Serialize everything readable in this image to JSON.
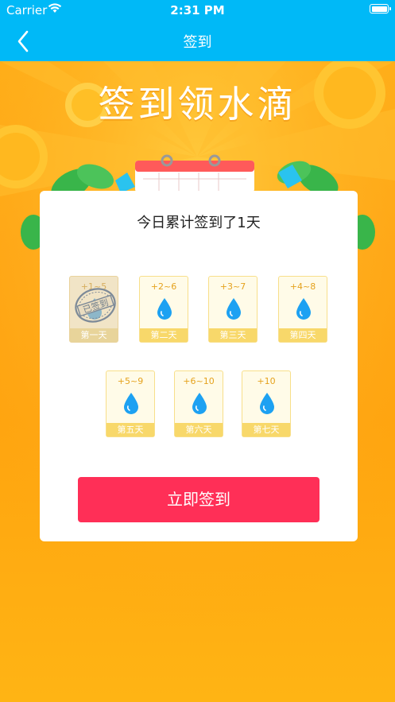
{
  "status_bar": {
    "carrier": "Carrier",
    "time": "2:31 PM"
  },
  "nav": {
    "title": "签到"
  },
  "banner": {
    "title": "签到领水滴"
  },
  "card": {
    "summary": "今日累计签到了1天",
    "days": [
      {
        "reward": "+1~5",
        "label": "第一天",
        "signed": true
      },
      {
        "reward": "+2~6",
        "label": "第二天",
        "signed": false
      },
      {
        "reward": "+3~7",
        "label": "第三天",
        "signed": false
      },
      {
        "reward": "+4~8",
        "label": "第四天",
        "signed": false
      },
      {
        "reward": "+5~9",
        "label": "第五天",
        "signed": false
      },
      {
        "reward": "+6~10",
        "label": "第六天",
        "signed": false
      },
      {
        "reward": "+10",
        "label": "第七天",
        "signed": false
      }
    ],
    "stamp_text": "已签到",
    "button_label": "立即签到"
  },
  "colors": {
    "nav_bg": "#00b9f7",
    "page_bg": "#ffa514",
    "button_bg": "#ff2f57",
    "reward_text": "#e5a21d",
    "drop_blue": "#1da1f2"
  },
  "icons": {
    "back": "chevron-left-icon",
    "wifi": "wifi-icon",
    "battery": "battery-icon",
    "drop": "water-drop-icon",
    "stamp": "signed-stamp-icon"
  }
}
